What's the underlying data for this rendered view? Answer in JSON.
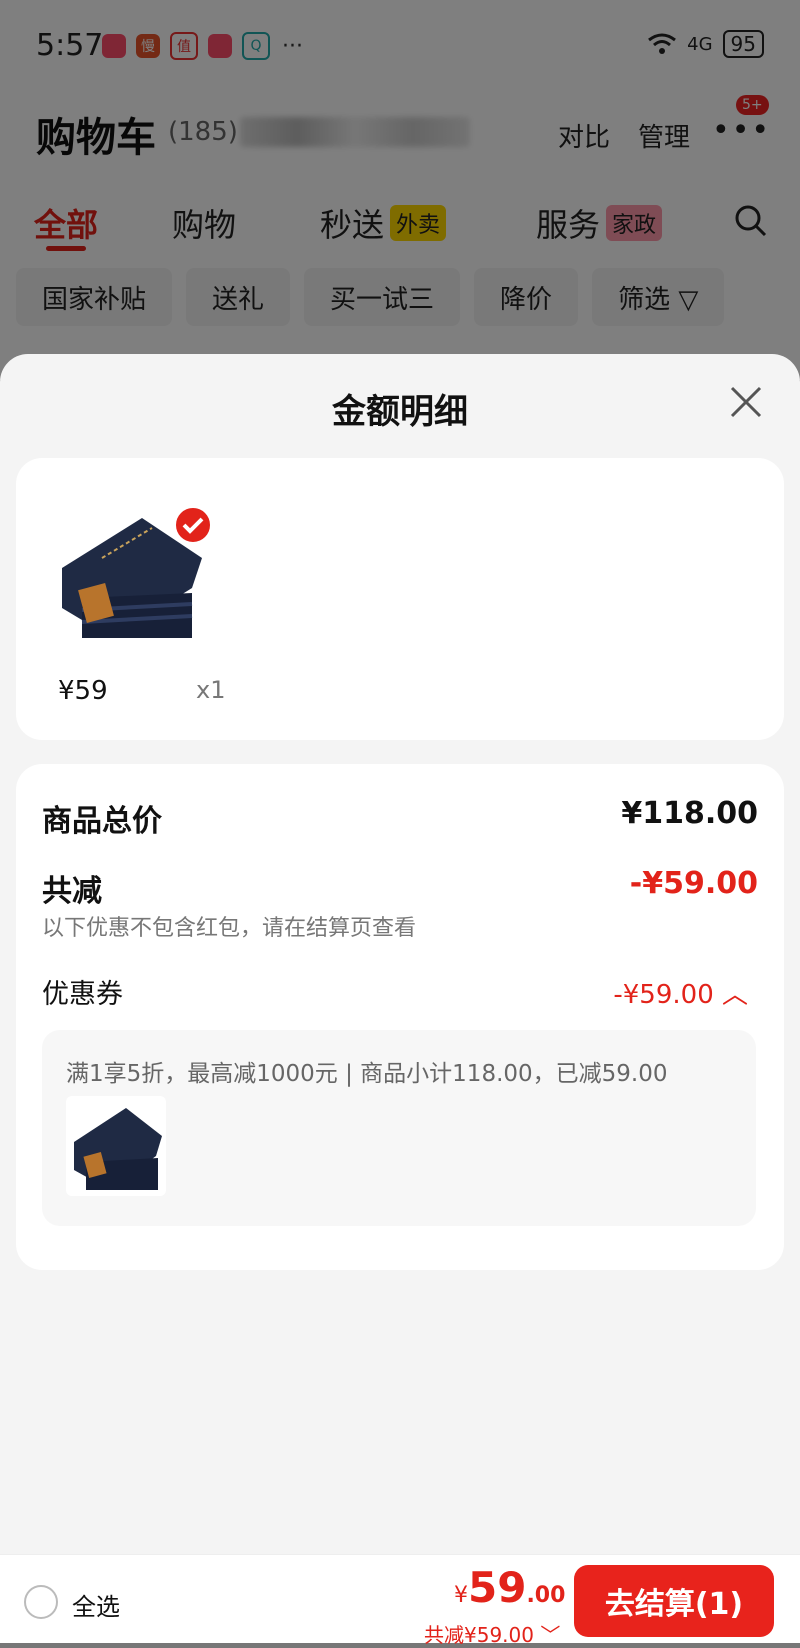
{
  "status_bar": {
    "time": "5:57",
    "app_badges": [
      "",
      "慢",
      "值",
      "",
      "Q"
    ],
    "more": "···",
    "signal": "4G",
    "battery": "95"
  },
  "cart": {
    "title": "购物车",
    "count": "(185)",
    "compare": "对比",
    "manage": "管理",
    "more": "•••",
    "badge": "5+"
  },
  "tabs": [
    {
      "label": "全部"
    },
    {
      "label": "购物"
    },
    {
      "label": "秒送",
      "tag": "外卖"
    },
    {
      "label": "服务",
      "tag": "家政"
    }
  ],
  "chips": [
    "国家补贴",
    "送礼",
    "买一试三",
    "降价",
    "筛选 ▽"
  ],
  "sheet": {
    "title": "金额明细",
    "item": {
      "price": "¥59",
      "qty": "x1"
    },
    "summary": {
      "goods_total_label": "商品总价",
      "goods_total_value": "¥118.00",
      "discount_label": "共减",
      "discount_value": "-¥59.00",
      "note": "以下优惠不包含红包，请在结算页查看",
      "coupon_label": "优惠券",
      "coupon_value": "-¥59.00 ︿",
      "coupon_desc": "满1享5折，最高减1000元 | 商品小计118.00，已减59.00"
    }
  },
  "bottom_bar": {
    "select_all": "全选",
    "yen": "¥",
    "price_int": "59",
    "price_dec": ".00",
    "total_discount": "共减¥59.00 ﹀",
    "checkout": "去结算(1)"
  },
  "colors": {
    "accent": "#e2231a",
    "sheet_bg": "#f4f4f4"
  }
}
